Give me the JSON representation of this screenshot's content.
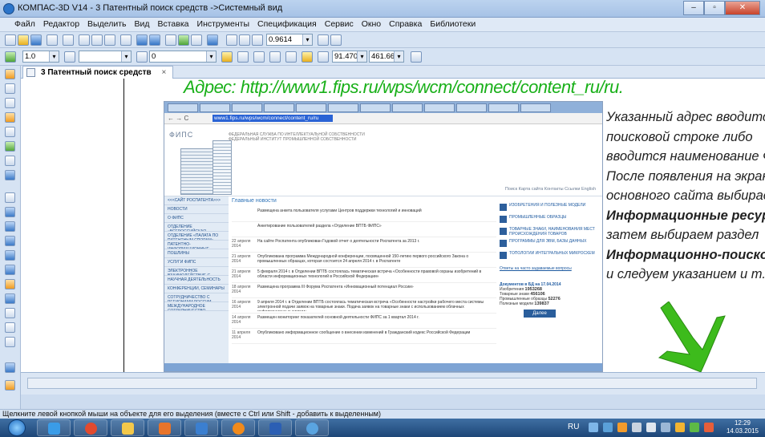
{
  "window": {
    "title": "КОМПАС-3D V14 - 3 Патентный поиск средств ->Системный вид",
    "controls": [
      "–",
      "▫",
      "✕"
    ]
  },
  "menu": [
    "Файл",
    "Редактор",
    "Выделить",
    "Вид",
    "Вставка",
    "Инструменты",
    "Спецификация",
    "Сервис",
    "Окно",
    "Справка",
    "Библиотеки"
  ],
  "toolbar": {
    "zoom_value": "0.9614",
    "line_width": "1.0",
    "layer": "0",
    "coord_x": "91.4707",
    "coord_y": "461.660"
  },
  "doc_tab": {
    "label": "3 Патентный поиск средств",
    "close": "×"
  },
  "canvas": {
    "address": "Адрес: http://www1.fips.ru/wps/wcm/connect/content_ru/ru.",
    "notes": [
      {
        "text": "Указанный адрес вводится в",
        "bold": false
      },
      {
        "text": "поисковой строке либо",
        "bold": false
      },
      {
        "text": "вводится наименование ФИПС.",
        "bold": false
      },
      {
        "text": "После появления на экране",
        "bold": false
      },
      {
        "text": "основного сайта выбираем",
        "bold": false
      },
      {
        "text": "Информационные ресурсы,",
        "bold": true
      },
      {
        "text": "затем выбираем раздел",
        "bold": false
      },
      {
        "text": "Информационно-поисковая",
        "bold": true
      },
      {
        "text": "и следуем указанием и т.д.",
        "bold": false
      }
    ]
  },
  "browser": {
    "url": "www1.fips.ru/wps/wcm/connect/content_ru/ru",
    "logo": "ФИПС",
    "org": "ФЕДЕРАЛЬНАЯ СЛУЖБА ПО ИНТЕЛЛЕКТУАЛЬНОЙ СОБСТВЕННОСТИ\nФЕДЕРАЛЬНЫЙ ИНСТИТУТ ПРОМЫШЛЕННОЙ СОБСТВЕННОСТИ",
    "header_links": "Поиск  Карта сайта  Контакты  Ссылки  English",
    "main_title": "Главные новости",
    "sidebar": [
      "<<<САЙТ РОСПАТЕНТА>>>",
      "НОВОСТИ",
      "О ФИПС",
      "ОТДЕЛЕНИЕ «ВСЕРОССИЙСКАЯ ПАТЕНТНО-ТЕХНИЧЕСКАЯ БИБЛИОТЕКА»",
      "ОТДЕЛЕНИЕ «ПАЛАТА ПО ПАТЕНТНЫМ СПОРАМ»",
      "ПАТЕНТНО-ИНФОРМАЦИОННЫЕ ПРОДУКТЫ",
      "ПОШЛИНЫ",
      "УСЛУГИ ФИПС",
      "ЭЛЕКТРОННОЕ ВЗАИМОДЕЙСТВИЕ С ЗАЯВИТЕЛЯМИ",
      "НАУЧНАЯ ДЕЯТЕЛЬНОСТЬ",
      "КОНФЕРЕНЦИИ, СЕМИНАРЫ",
      "СОТРУДНИЧЕСТВО С РЕГИОНАМИ РОССИИ",
      "МЕЖДУНАРОДНОЕ СОТРУДНИЧЕСТВО"
    ],
    "news": [
      {
        "date": "",
        "text": "Размещена анкета пользователя услугами Центров поддержки технологий и инноваций"
      },
      {
        "date": "",
        "text": "Анкетирование пользователей раздела «Отделение ВПТБ ФИПС»"
      },
      {
        "date": "22 апреля 2014",
        "text": "На сайте Роспатента опубликован Годовой отчет о деятельности Роспатента за 2013 г."
      },
      {
        "date": "21 апреля 2014",
        "text": "Опубликована программа Международной конференции, посвященной 150-летию первого российского Закона о промышленных образцах, которая состоится 24 апреля 2014 г. в Роспатенте"
      },
      {
        "date": "21 апреля 2014",
        "text": "5 февраля 2014 г. в Отделении ВПТБ состоялась тематическая встреча «Особенности правовой охраны изобретений в области информационных технологий в Российской Федерации»"
      },
      {
        "date": "18 апреля 2014",
        "text": "Размещена программа III Форума Роспатента «Инновационный потенциал России»"
      },
      {
        "date": "16 апреля 2014",
        "text": "9 апреля 2014 г. в Отделении ВПТБ состоялась тематическая встреча «Особенности настройки рабочего места системы электронной подачи заявок на товарные знаки. Подача заявок на товарные знаки с использованием облачных информационных систем»"
      },
      {
        "date": "14 апреля 2014",
        "text": "Размещен мониторинг показателей основной деятельности ФИПС за 1 квартал 2014 г."
      },
      {
        "date": "11 апреля 2014",
        "text": "Опубликовано информационное сообщение о внесении изменений в Гражданский кодекс Российской Федерации"
      }
    ],
    "right_links": [
      "ИЗОБРЕТЕНИЯ И ПОЛЕЗНЫЕ МОДЕЛИ",
      "ПРОМЫШЛЕННЫЕ ОБРАЗЦЫ",
      "ТОВАРНЫЕ ЗНАКИ, НАИМЕНОВАНИЯ МЕСТ ПРОИСХОЖДЕНИЯ ТОВАРОВ",
      "ПРОГРАММЫ ДЛЯ ЭВМ, БАЗЫ ДАННЫХ",
      "ТОПОЛОГИИ ИНТЕГРАЛЬНЫХ МИКРОСХЕМ"
    ],
    "faq": "Ответы на часто задаваемые вопросы",
    "stats_title": "Документов в БД на 17.04.2014",
    "stats": [
      {
        "k": "Изобретения",
        "v": "1953268"
      },
      {
        "k": "Товарные знаки",
        "v": "456106"
      },
      {
        "k": "Промышленные образцы",
        "v": "52276"
      },
      {
        "k": "Полезные модели",
        "v": "139837"
      }
    ],
    "more": "Далее"
  },
  "status": "Щелкните левой кнопкой мыши на объекте для его выделения (вместе с Ctrl или Shift - добавить к выделенным)",
  "taskbar": {
    "lang": "RU",
    "time": "12:29",
    "date": "14.03.2015"
  },
  "colors": {
    "address": "#19b019",
    "arrow": "#3dbb1c"
  }
}
